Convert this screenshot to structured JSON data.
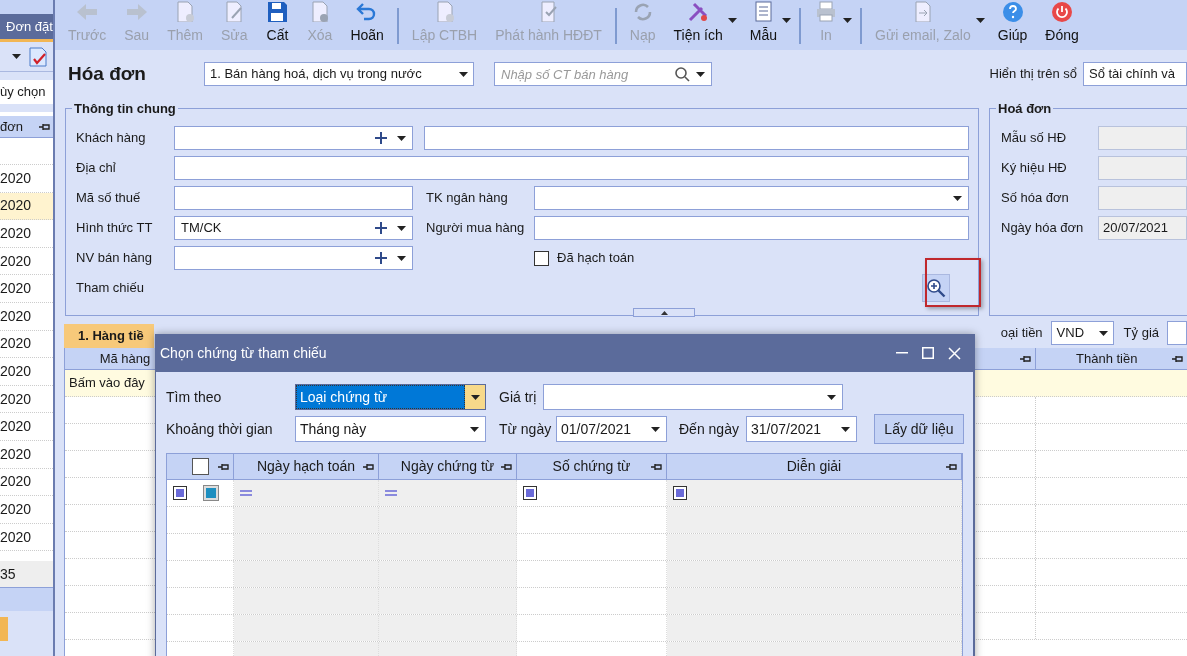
{
  "left_panel": {
    "tab": "Đơn đặt",
    "filter": "ùy chọn",
    "column": "đơn",
    "rows": [
      {
        "text": "2020",
        "selected": false
      },
      {
        "text": "2020",
        "selected": true
      },
      {
        "text": "2020",
        "selected": false
      },
      {
        "text": "2020",
        "selected": false
      },
      {
        "text": "2020",
        "selected": false
      },
      {
        "text": "2020",
        "selected": false
      },
      {
        "text": "2020",
        "selected": false
      },
      {
        "text": "2020",
        "selected": false
      },
      {
        "text": "2020",
        "selected": false
      },
      {
        "text": "2020",
        "selected": false
      },
      {
        "text": "2020",
        "selected": false
      },
      {
        "text": "2020",
        "selected": false
      },
      {
        "text": "2020",
        "selected": false
      },
      {
        "text": "2020",
        "selected": false
      }
    ],
    "footer": "35"
  },
  "toolbar": [
    {
      "label": "Trước",
      "kind": "back",
      "disabled": true,
      "dropdown": false
    },
    {
      "label": "Sau",
      "kind": "forward",
      "disabled": true,
      "dropdown": false
    },
    {
      "label": "Thêm",
      "kind": "add",
      "disabled": true,
      "dropdown": false
    },
    {
      "label": "Sửa",
      "kind": "edit",
      "disabled": true,
      "dropdown": false
    },
    {
      "label": "Cất",
      "kind": "save",
      "disabled": false,
      "dropdown": false
    },
    {
      "label": "Xóa",
      "kind": "delete",
      "disabled": true,
      "dropdown": false
    },
    {
      "label": "Hoãn",
      "kind": "undo",
      "disabled": false,
      "dropdown": false
    },
    {
      "kind": "separator"
    },
    {
      "label": "Lập CTBH",
      "kind": "add",
      "disabled": true,
      "dropdown": false
    },
    {
      "label": "Phát hành HĐĐT",
      "kind": "publish",
      "disabled": true,
      "dropdown": false
    },
    {
      "kind": "separator"
    },
    {
      "label": "Nạp",
      "kind": "reload",
      "disabled": true,
      "dropdown": false
    },
    {
      "label": "Tiện ích",
      "kind": "tools",
      "disabled": false,
      "dropdown": true
    },
    {
      "label": "Mẫu",
      "kind": "template",
      "disabled": false,
      "dropdown": true
    },
    {
      "kind": "separator"
    },
    {
      "label": "In",
      "kind": "print",
      "disabled": true,
      "dropdown": true
    },
    {
      "kind": "separator"
    },
    {
      "label": "Gửi email, Zalo",
      "kind": "send",
      "disabled": true,
      "dropdown": true
    },
    {
      "label": "Giúp",
      "kind": "help",
      "disabled": false,
      "dropdown": false
    },
    {
      "label": "Đóng",
      "kind": "power",
      "disabled": false,
      "dropdown": false
    }
  ],
  "header": {
    "title": "Hóa đơn",
    "type_select": "1. Bán hàng hoá, dịch vụ trong nước",
    "search_placeholder": "Nhập số CT bán hàng",
    "ledger_label": "Hiển thị trên sổ",
    "ledger_value": "Sổ tài chính và"
  },
  "general": {
    "legend": "Thông tin chung",
    "customer_label": "Khách hàng",
    "address_label": "Địa chỉ",
    "tax_label": "Mã số thuế",
    "bank_label": "TK ngân hàng",
    "payment_label": "Hình thức TT",
    "payment_value": "TM/CK",
    "buyer_label": "Người mua hàng",
    "staff_label": "NV bán hàng",
    "posted_label": "Đã hạch toán",
    "posted_checked": false,
    "reference_label": "Tham chiếu"
  },
  "invoice": {
    "legend": "Hoá đơn",
    "fields": [
      {
        "label": "Mẫu số HĐ"
      },
      {
        "label": "Ký hiệu HĐ"
      },
      {
        "label": "Số hóa đơn"
      },
      {
        "label": "Ngày hóa đơn",
        "value": "20/07/2021"
      }
    ]
  },
  "detail": {
    "tab": "1. Hàng tiề",
    "column_1": "Mã hàng",
    "row_hint": "Bấm vào đây",
    "currency_label": "oại tiền",
    "currency": "VND",
    "rate_label": "Tỷ giá",
    "amount_column": "Thành tiền"
  },
  "dialog": {
    "title": "Chọn chứng từ tham chiếu",
    "search_by_label": "Tìm theo",
    "search_by": "Loại chứng từ",
    "value_label": "Giá trị",
    "period_label": "Khoảng thời gian",
    "period": "Tháng này",
    "from_label": "Từ ngày",
    "from": "01/07/2021",
    "to_label": "Đến ngày",
    "to": "31/07/2021",
    "fetch_button": "Lấy dữ liệu",
    "select_all_checked": false,
    "columns": [
      "Ngày hạch toán",
      "Ngày chứng từ",
      "Số chứng từ",
      "Diễn giải"
    ]
  }
}
